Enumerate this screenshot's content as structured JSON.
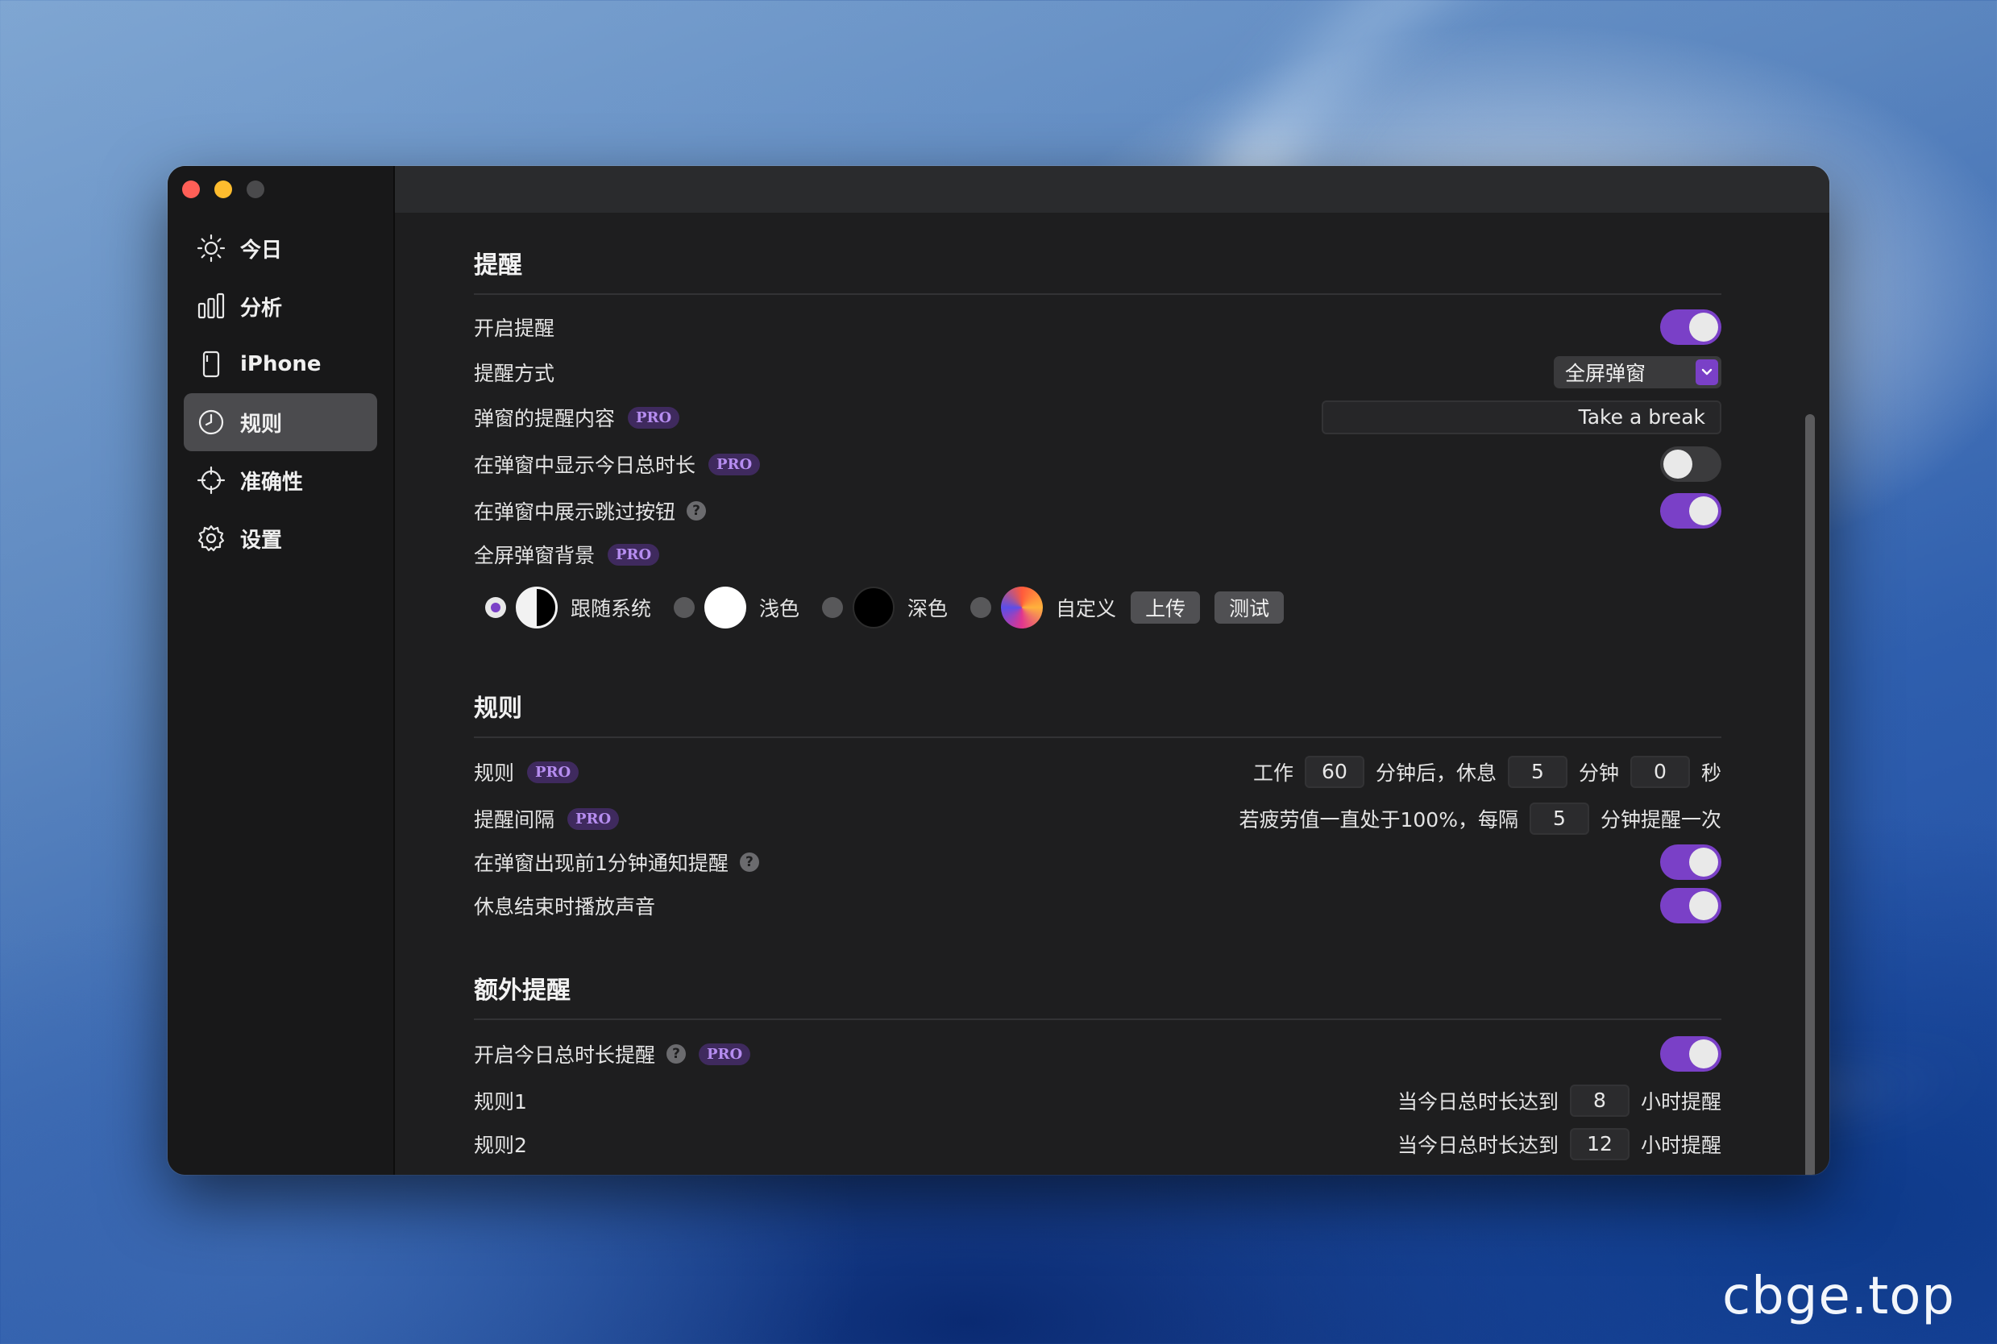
{
  "sidebar": {
    "items": [
      {
        "label": "今日",
        "icon": "sun-icon"
      },
      {
        "label": "分析",
        "icon": "bar-chart-icon"
      },
      {
        "label": "iPhone",
        "icon": "phone-icon"
      },
      {
        "label": "规则",
        "icon": "clock-icon",
        "active": true
      },
      {
        "label": "准确性",
        "icon": "crosshair-icon"
      },
      {
        "label": "设置",
        "icon": "gear-icon"
      }
    ]
  },
  "pro_label": "PRO",
  "help_glyph": "?",
  "reminder": {
    "title": "提醒",
    "enable": {
      "label": "开启提醒",
      "on": true
    },
    "method": {
      "label": "提醒方式",
      "value": "全屏弹窗"
    },
    "content": {
      "label": "弹窗的提醒内容",
      "value": "Take a break"
    },
    "show_total": {
      "label": "在弹窗中显示今日总时长",
      "on": false
    },
    "skip_button": {
      "label": "在弹窗中展示跳过按钮",
      "on": true
    },
    "background": {
      "label": "全屏弹窗背景",
      "options": [
        "跟随系统",
        "浅色",
        "深色",
        "自定义"
      ],
      "selected": "跟随系统",
      "upload_label": "上传",
      "test_label": "测试"
    }
  },
  "rules": {
    "title": "规则",
    "rule": {
      "label": "规则",
      "work_prefix": "工作",
      "work_minutes": "60",
      "rest_prefix": "分钟后，休息",
      "rest_minutes": "5",
      "minutes_unit": "分钟",
      "rest_seconds": "0",
      "seconds_unit": "秒"
    },
    "interval": {
      "label": "提醒间隔",
      "prefix": "若疲劳值一直处于100%，每隔",
      "minutes": "5",
      "suffix": "分钟提醒一次"
    },
    "notify_before": {
      "label": "在弹窗出现前1分钟通知提醒",
      "on": true
    },
    "play_sound": {
      "label": "休息结束时播放声音",
      "on": true
    }
  },
  "extra": {
    "title": "额外提醒",
    "enable_total": {
      "label": "开启今日总时长提醒",
      "on": true
    },
    "rule1": {
      "label": "规则1",
      "prefix": "当今日总时长达到",
      "hours": "8",
      "suffix": "小时提醒"
    },
    "rule2": {
      "label": "规则2",
      "prefix": "当今日总时长达到",
      "hours": "12",
      "suffix": "小时提醒"
    }
  },
  "watermark": "cbge.top",
  "colors": {
    "accent": "#7a40c7",
    "pro_text": "#b68df0",
    "pro_bg": "#3f2a5e"
  }
}
